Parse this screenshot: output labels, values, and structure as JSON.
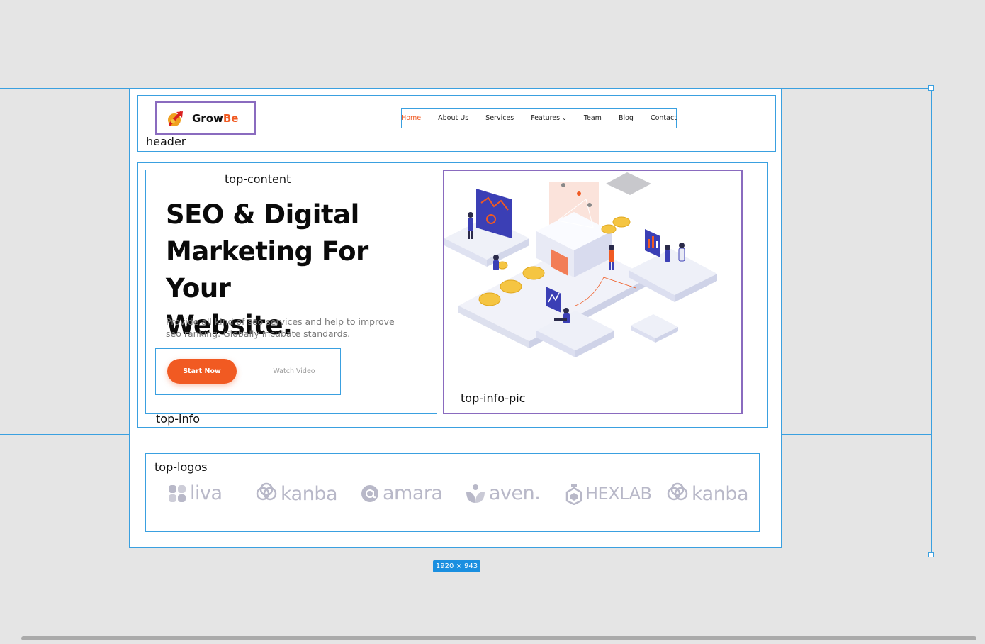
{
  "labels": {
    "header": "header",
    "top_content": "top-content",
    "top_info": "top-info",
    "top_info_pic": "top-info-pic",
    "top_logos": "top-logos"
  },
  "logo": {
    "part1": "Grow",
    "part2": "Be"
  },
  "nav": {
    "items": [
      "Home",
      "About Us",
      "Services",
      "Features",
      "Team",
      "Blog",
      "Contact"
    ],
    "features_chevron": "⌄"
  },
  "hero": {
    "title_line1": "SEO & Digital",
    "title_line2": "Marketing For Your",
    "title_line3": "Website.",
    "desc_line1": "Provide all kind of seo services and help to improve",
    "desc_line2": "seo ranking. Globally incubate standards.",
    "start_label": "Start Now",
    "watch_label": "Watch Video"
  },
  "brands": [
    "liva",
    "kanba",
    "amara",
    "aven.",
    "HEXLAB",
    "kanba"
  ],
  "frame_size": "1920 × 943",
  "colors": {
    "accent": "#f15a22",
    "selection": "#3aa0e0",
    "brand_gray": "#b8b8c8",
    "isometric_blue": "#3b3fb5"
  },
  "icons": [
    "rocket-logo-icon",
    "chevron-down-icon",
    "liva-logo-icon",
    "kanba-logo-icon",
    "amara-logo-icon",
    "aven-logo-icon",
    "hexlab-logo-icon"
  ]
}
